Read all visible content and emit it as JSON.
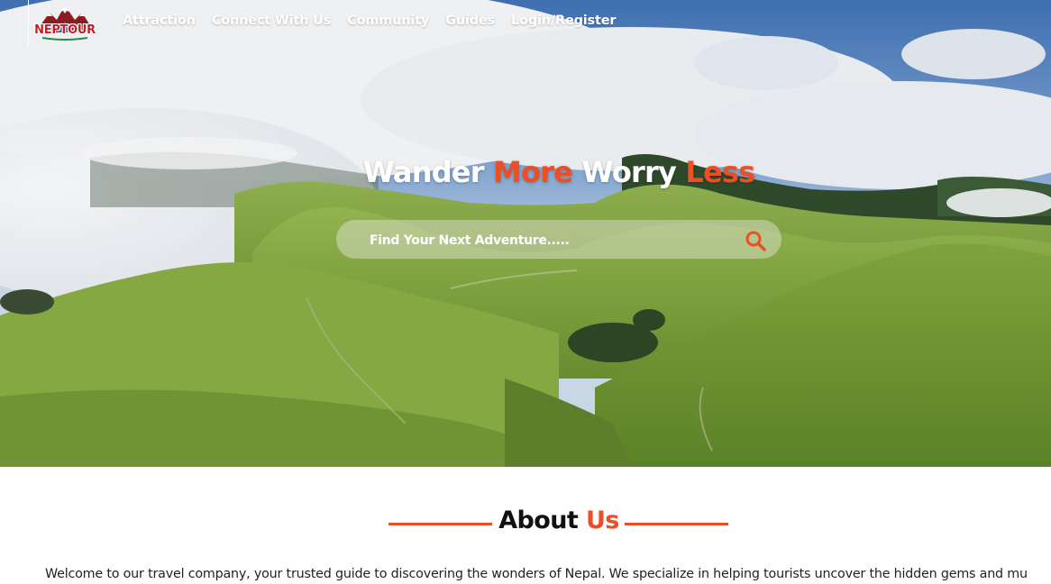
{
  "brand": {
    "logo_text": "NEPTOUR",
    "accent_color": "#ec4e26"
  },
  "nav": {
    "items": [
      {
        "label": "Attraction"
      },
      {
        "label": "Connect With Us"
      },
      {
        "label": "Community"
      },
      {
        "label": "Guides"
      },
      {
        "label": "Login/Register"
      }
    ]
  },
  "hero": {
    "headline": {
      "part1": "Wander",
      "part2": "More",
      "part3": "Worry",
      "part4": "Less"
    },
    "search": {
      "placeholder": "Find Your Next Adventure.....",
      "icon": "search-icon"
    },
    "background": "green hills with clouds and blue sky"
  },
  "about": {
    "title_part1": "About",
    "title_part2": "Us",
    "text": "Welcome to our travel company, your trusted guide to discovering the wonders of Nepal. We specialize in helping tourists uncover the hidden gems and mu"
  }
}
